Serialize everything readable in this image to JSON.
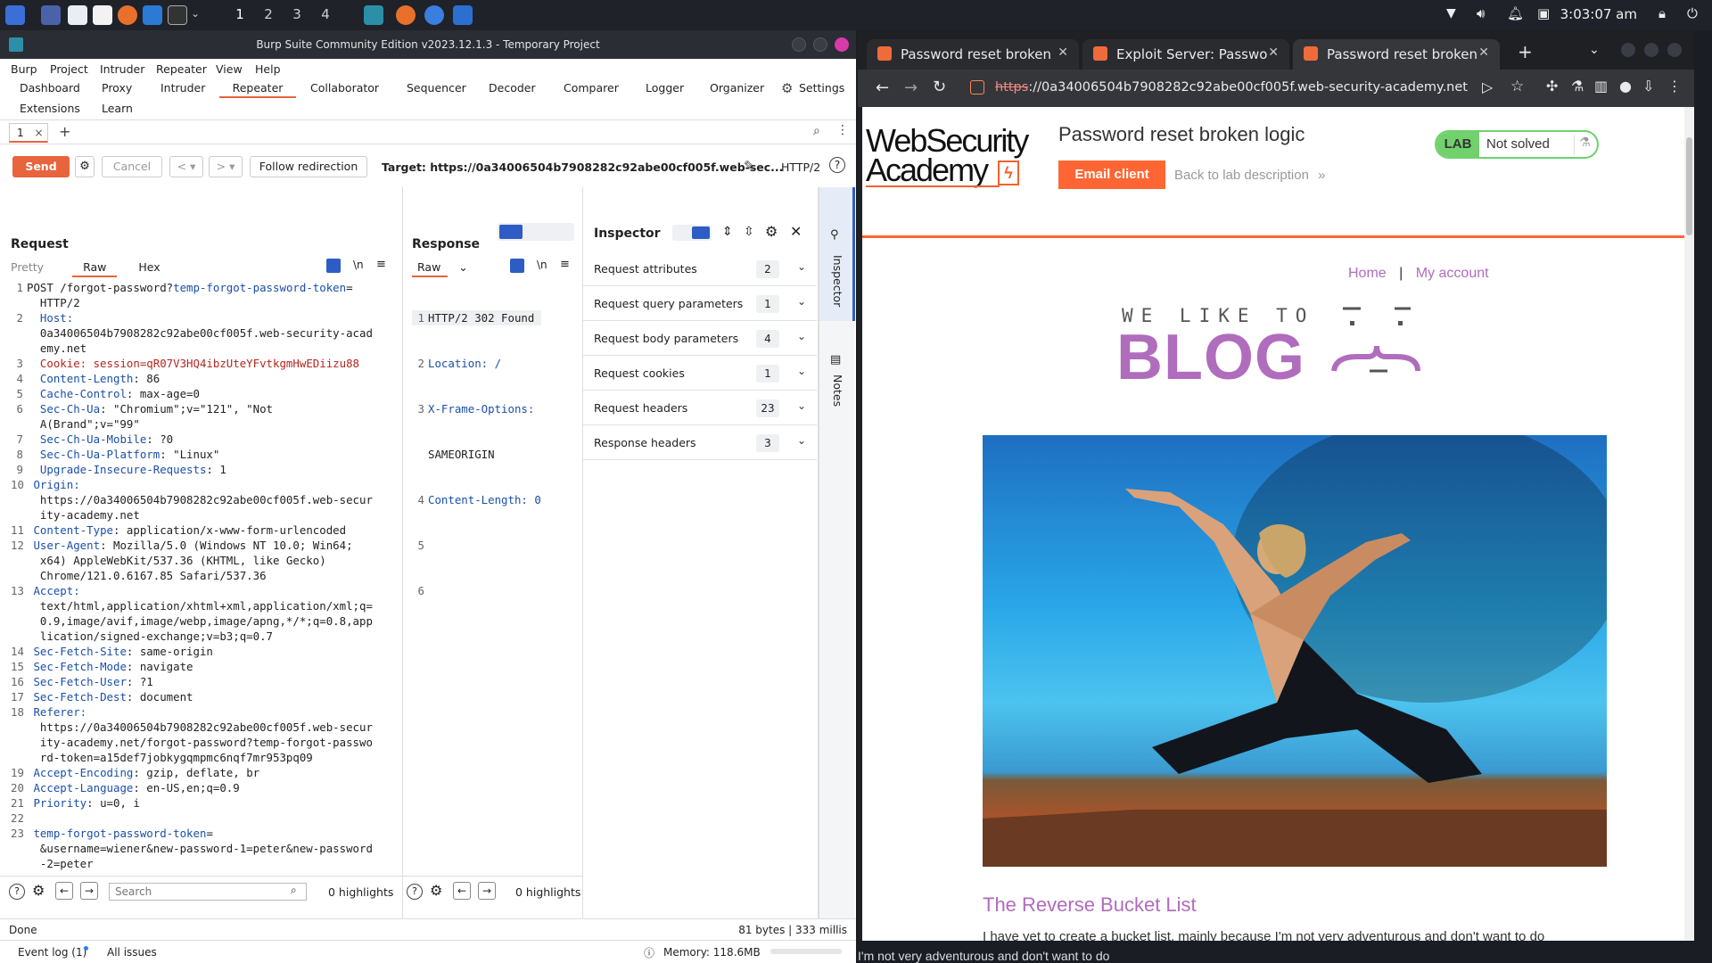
{
  "taskbar": {
    "workspaces": [
      "1",
      "2",
      "3",
      "4"
    ],
    "clock": "3:03:07 am"
  },
  "burp": {
    "title": "Burp Suite Community Edition v2023.12.1.3 - Temporary Project",
    "menu": [
      "Burp",
      "Project",
      "Intruder",
      "Repeater",
      "View",
      "Help"
    ],
    "tabs_row1": [
      "Dashboard",
      "Proxy",
      "Intruder",
      "Repeater",
      "Collaborator",
      "Sequencer",
      "Decoder",
      "Comparer",
      "Logger",
      "Organizer",
      "Settings"
    ],
    "tabs_row2": [
      "Extensions",
      "Learn"
    ],
    "active_tab": "Repeater",
    "subtab": "1",
    "subtab_close": "×",
    "add_tab": "+",
    "toolbar": {
      "send": "Send",
      "cancel": "Cancel",
      "follow": "Follow redirection",
      "target": "Target: https://0a34006504b7908282c92abe00cf005f.web-sec...",
      "http": "HTTP/2"
    },
    "request": {
      "title": "Request",
      "views": [
        "Pretty",
        "Raw",
        "Hex"
      ],
      "footer_search": "Search",
      "highlights": "0 highlights"
    },
    "response": {
      "title": "Response",
      "view": "Raw",
      "highlights": "0 highlights",
      "lines": [
        "HTTP/2 302 Found",
        "Location: /",
        "X-Frame-Options:",
        "SAMEORIGIN",
        "Content-Length: 0",
        "",
        ""
      ]
    },
    "inspector": {
      "title": "Inspector",
      "rows": [
        {
          "label": "Request attributes",
          "count": "2"
        },
        {
          "label": "Request query parameters",
          "count": "1"
        },
        {
          "label": "Request body parameters",
          "count": "4"
        },
        {
          "label": "Request cookies",
          "count": "1"
        },
        {
          "label": "Request headers",
          "count": "23"
        },
        {
          "label": "Response headers",
          "count": "3"
        }
      ],
      "side_tabs": [
        "Inspector",
        "Notes"
      ]
    },
    "status": {
      "left": "Done",
      "right": "81 bytes | 333 millis",
      "event_log": "Event log (1)",
      "issues": "All issues",
      "memory": "Memory: 118.6MB"
    }
  },
  "browser": {
    "tabs": [
      {
        "title": "Password reset broken lo"
      },
      {
        "title": "Exploit Server: Password"
      },
      {
        "title": "Password reset broken lo"
      }
    ],
    "new_tab": "+",
    "url_prefix": "https",
    "url_rest": "://0a34006504b7908282c92abe00cf005f.web-security-academy.net",
    "lab": {
      "logo_line1": "WebSecurity",
      "logo_line2": "Academy",
      "title": "Password reset broken logic",
      "email_client": "Email client",
      "back": "Back to lab description",
      "badge_lab": "LAB",
      "badge_status": "Not solved"
    },
    "nav": {
      "home": "Home",
      "sep": "|",
      "account": "My account"
    },
    "blog": {
      "tagline": "WE LIKE TO",
      "word": "BLOG"
    },
    "post": {
      "title": "The Reverse Bucket List",
      "excerpt": "I have yet to create a bucket list, mainly because I'm not very adventurous and don't want to do"
    },
    "peek_text": "I'm not very adventurous and don't want to do"
  }
}
